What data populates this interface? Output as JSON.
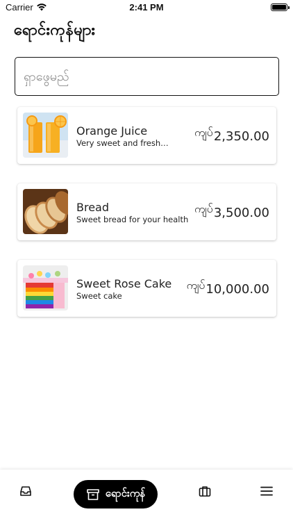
{
  "status_bar": {
    "carrier": "Carrier",
    "time": "2:41 PM"
  },
  "page": {
    "title": "ရောင်းကုန်များ"
  },
  "search": {
    "placeholder": "ရှာဖွေမည်"
  },
  "products": [
    {
      "name": "Orange Juice",
      "description": "Very sweet and freshly ...",
      "currency": "ကျပ်",
      "price": "2,350.00",
      "image_icon": "orange-juice-photo"
    },
    {
      "name": "Bread",
      "description": "Sweet bread for your health",
      "currency": "ကျပ်",
      "price": "3,500.00",
      "image_icon": "bread-photo"
    },
    {
      "name": "Sweet Rose Cake",
      "description": "Sweet cake",
      "currency": "ကျပ်",
      "price": "10,000.00",
      "image_icon": "rainbow-cake-photo"
    }
  ],
  "tab_bar": {
    "tabs": [
      {
        "icon": "inbox-icon"
      },
      {
        "icon": "archive-box-icon",
        "label": "ရောင်းကုန်",
        "active": true
      },
      {
        "icon": "briefcase-icon"
      },
      {
        "icon": "menu-icon"
      }
    ]
  }
}
